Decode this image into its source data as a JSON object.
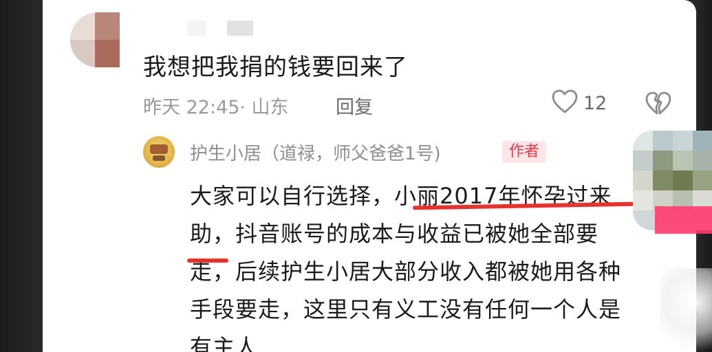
{
  "comment": {
    "text": "我想把我捐的钱要回来了",
    "meta": "昨天 22:45· 山东",
    "reply_label": "回复",
    "like_count": "12"
  },
  "reply": {
    "author": "护生小居（道禄，师父爸爸1号)",
    "badge": "作者",
    "lines": [
      "大家可以自行选择，小丽2017年怀孕过来",
      "助，抖音账号的成本与收益已被她全部要",
      "走，后续护生小居大部分收入都被她用各种",
      "手段要走，这里只有义工没有任何一个人是",
      "有主人"
    ]
  },
  "icons": {
    "like": "heart-outline-icon",
    "dislike": "broken-heart-icon"
  },
  "colors": {
    "badge_text": "#ee3346",
    "badge_bg": "#fde6e7",
    "underline": "#e8322d"
  }
}
